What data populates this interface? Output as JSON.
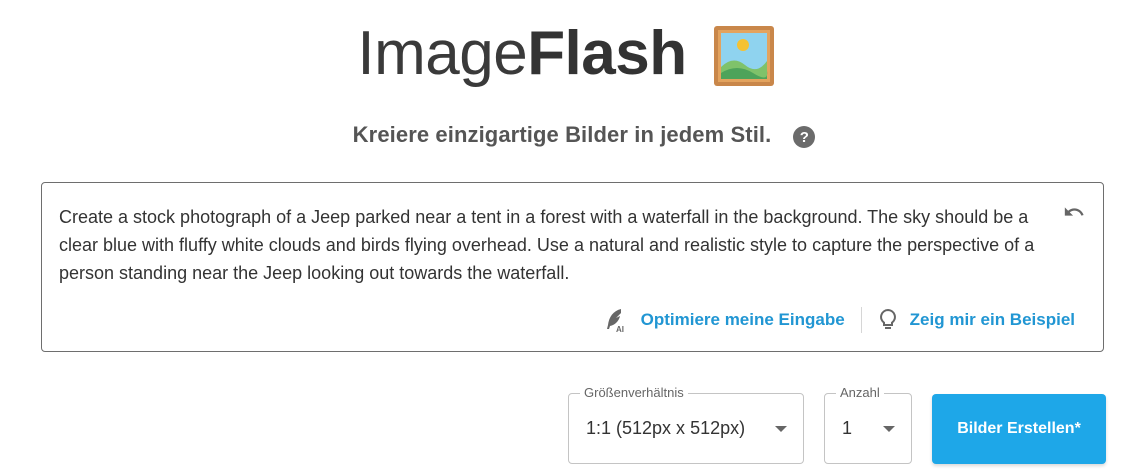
{
  "header": {
    "brand_light": "Image",
    "brand_bold": "Flash",
    "brand_icon": "framed-picture-icon"
  },
  "subtitle": {
    "text": "Kreiere einzigartige Bilder in jedem Stil.",
    "help_icon": "help-icon",
    "help_glyph": "?"
  },
  "prompt": {
    "value": "Create a stock photograph of a Jeep parked near a tent in a forest with a waterfall in the background. The sky should be a clear blue with fluffy white clouds and birds flying overhead. Use a natural and realistic style to capture the perspective of a person standing near the Jeep looking out towards the waterfall.",
    "undo_icon": "undo-icon",
    "optimize_label": "Optimiere meine Eingabe",
    "optimize_icon": "feather-ai-icon",
    "example_label": "Zeig mir ein Beispiel",
    "example_icon": "lightbulb-icon"
  },
  "controls": {
    "ratio_legend": "Größenverhältnis",
    "ratio_value": "1:1 (512px x 512px)",
    "count_legend": "Anzahl",
    "count_value": "1",
    "create_label": "Bilder Erstellen*"
  },
  "colors": {
    "accent": "#1ea7e8",
    "link": "#2196d3",
    "text": "#333333"
  }
}
